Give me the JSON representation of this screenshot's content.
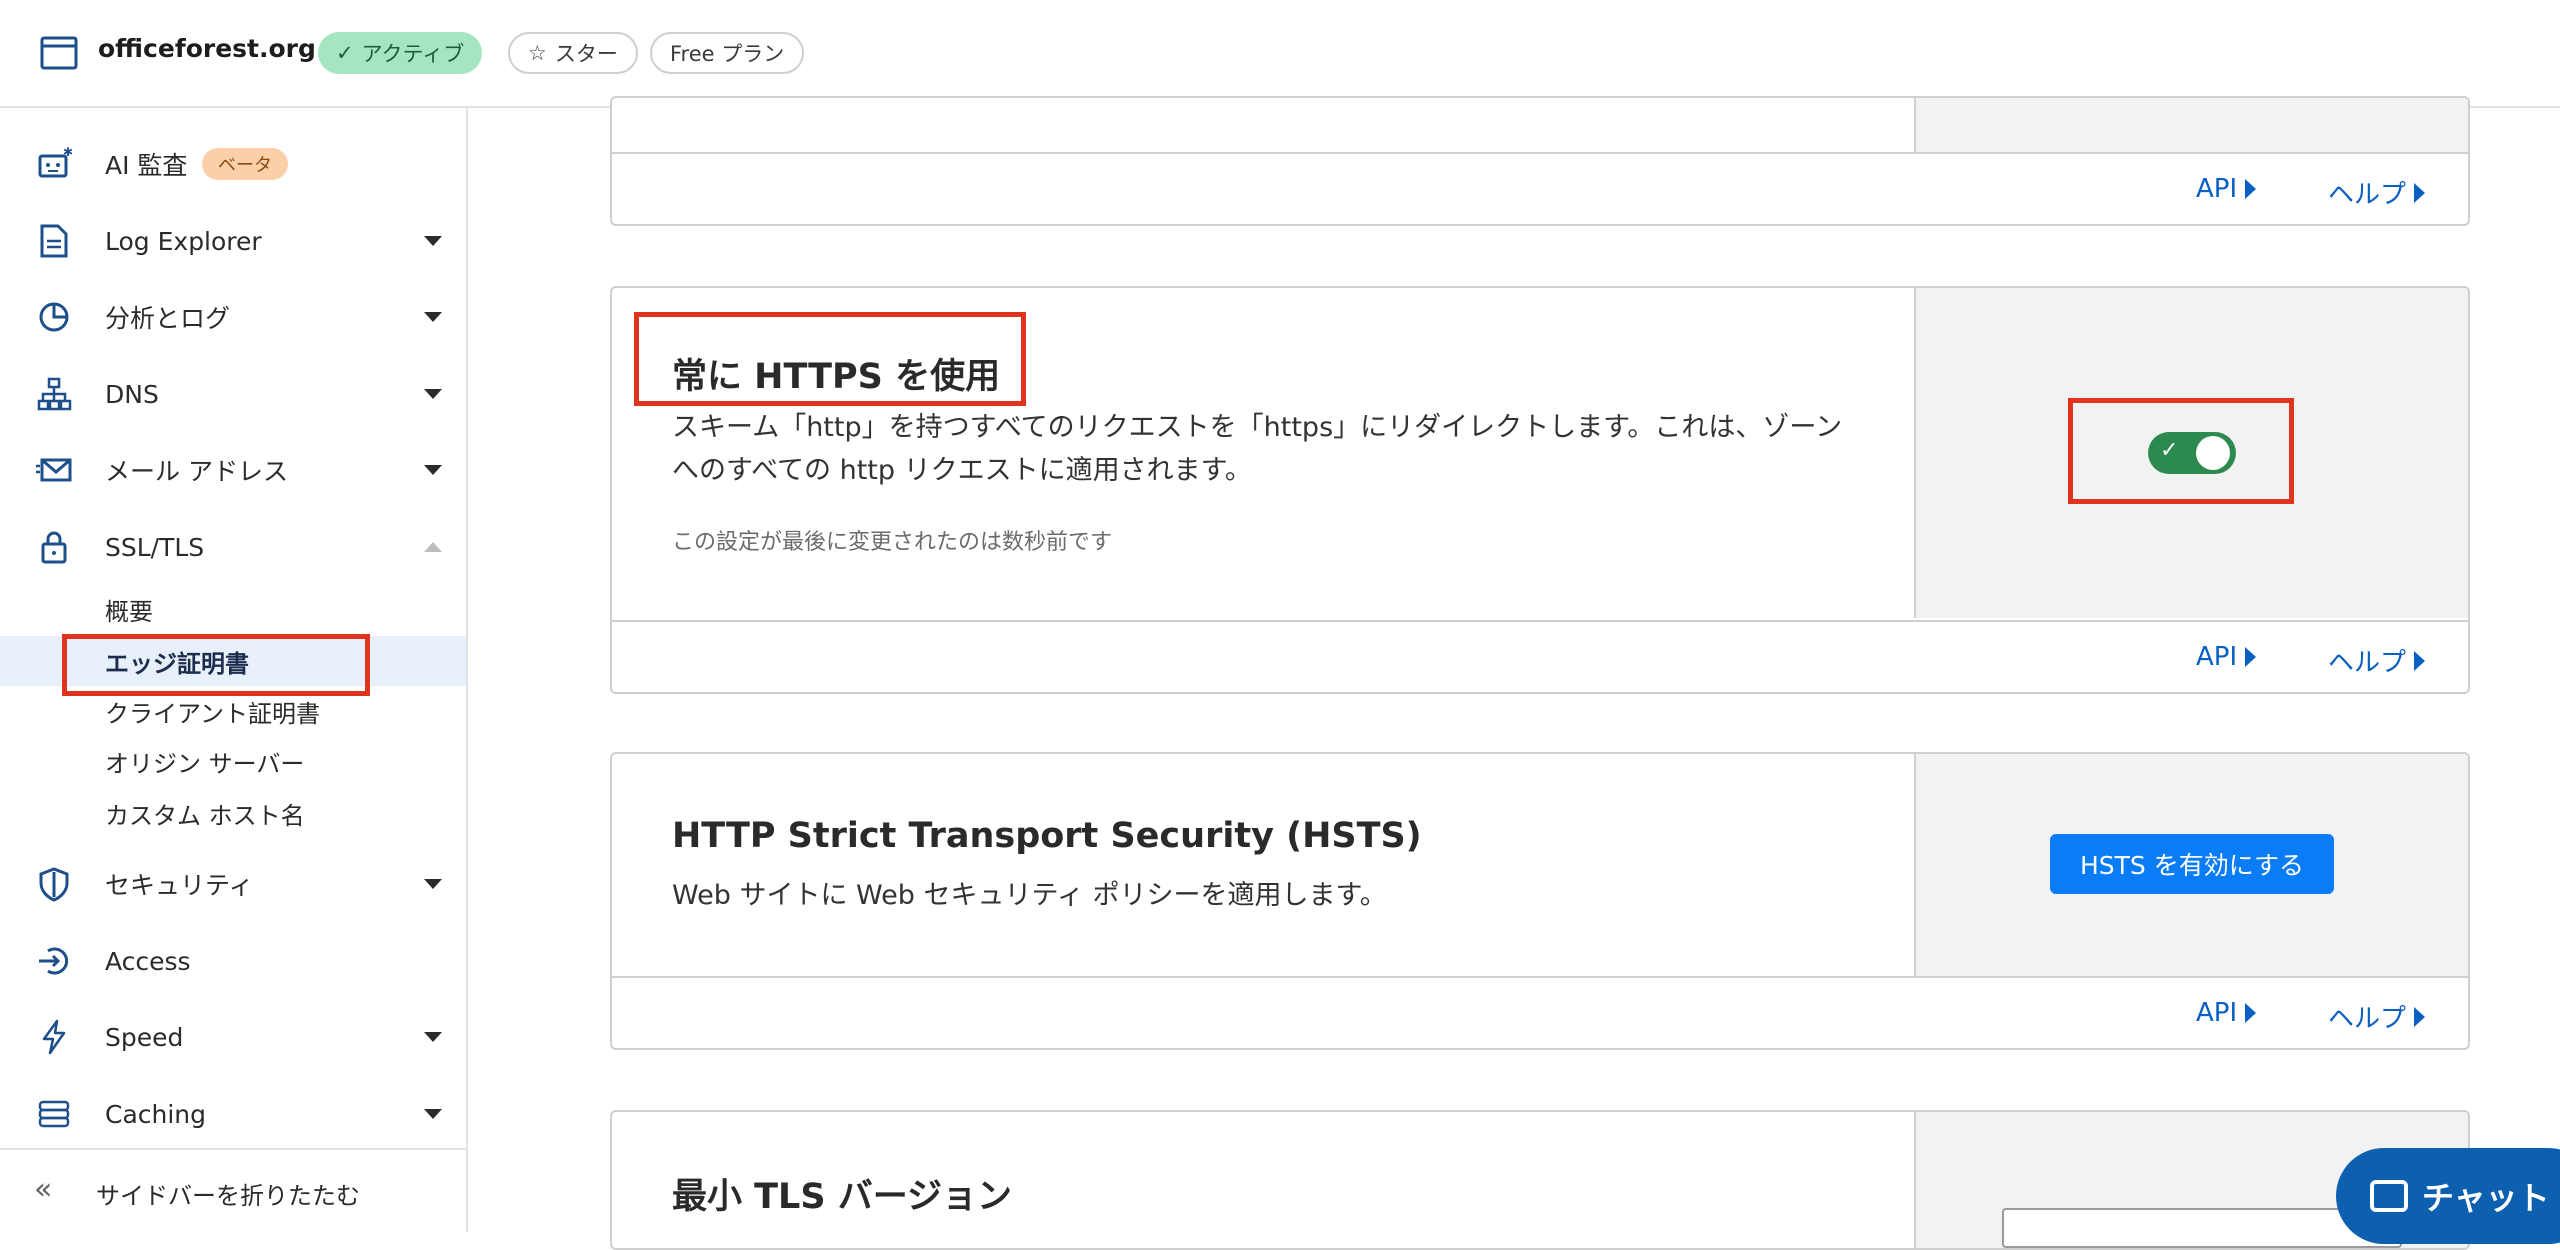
{
  "topbar": {
    "site_name": "officeforest.org",
    "status_badge": "アクティブ",
    "star_label": "スター",
    "plan_label": "Free プラン"
  },
  "sidebar": {
    "items": [
      {
        "label": "AI 監査",
        "icon": "ai-robot-icon",
        "badge": "ベータ"
      },
      {
        "label": "Log Explorer",
        "icon": "log-document-icon"
      },
      {
        "label": "分析とログ",
        "icon": "pie-chart-icon"
      },
      {
        "label": "DNS",
        "icon": "network-tree-icon"
      },
      {
        "label": "メール アドレス",
        "icon": "email-icon"
      },
      {
        "label": "SSL/TLS",
        "icon": "lock-icon"
      },
      {
        "label": "セキュリティ",
        "icon": "shield-icon"
      },
      {
        "label": "Access",
        "icon": "access-icon"
      },
      {
        "label": "Speed",
        "icon": "lightning-icon"
      },
      {
        "label": "Caching",
        "icon": "caching-icon"
      }
    ],
    "ssl_subitems": [
      "概要",
      "エッジ証明書",
      "クライアント証明書",
      "オリジン サーバー",
      "カスタム ホスト名"
    ],
    "collapse_label": "サイドバーを折りたたむ"
  },
  "links": {
    "api": "API",
    "help": "ヘルプ"
  },
  "cards": {
    "https": {
      "title": "常に HTTPS を使用",
      "description": "スキーム「http」を持つすべてのリクエストを「https」にリダイレクトします。これは、ゾーンへのすべての http リクエストに適用されます。",
      "meta": "この設定が最後に変更されたのは数秒前です",
      "enabled": true
    },
    "hsts": {
      "title": "HTTP Strict Transport Security (HSTS)",
      "description": "Web サイトに Web セキュリティ ポリシーを適用します。",
      "button": "HSTS を有効にする"
    },
    "tls": {
      "title": "最小 TLS バージョン"
    }
  },
  "chat": {
    "label": "チャット"
  },
  "colors": {
    "accent": "#0a7cf6",
    "toggle_on": "#2c8a4e",
    "highlight": "#e0341e",
    "chat": "#0d5fb0"
  }
}
